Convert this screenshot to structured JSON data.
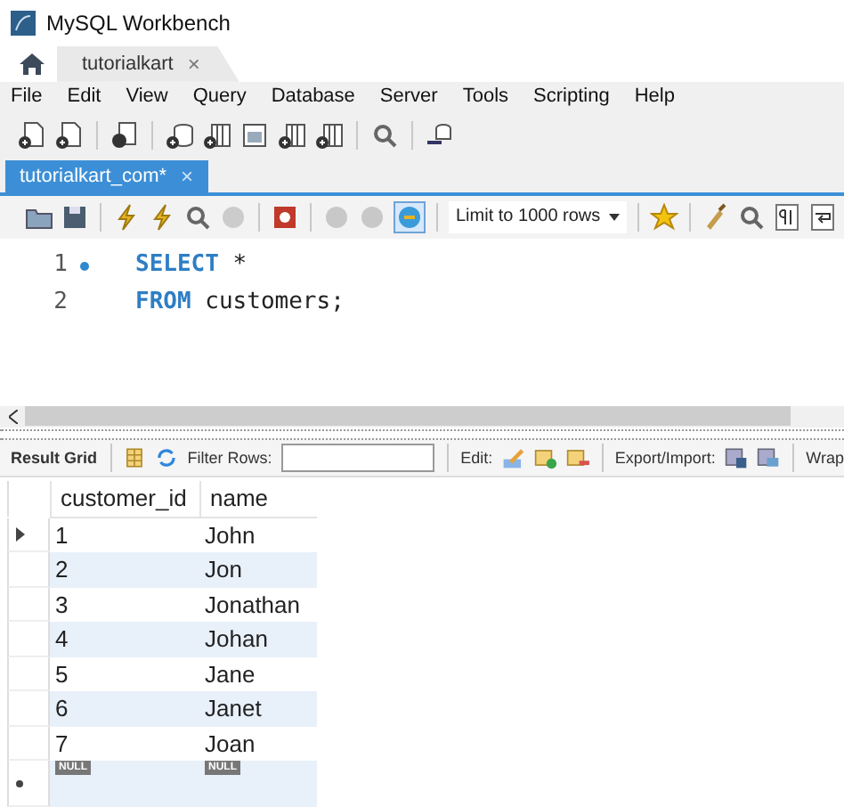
{
  "window": {
    "title": "MySQL Workbench"
  },
  "connection_tab": {
    "label": "tutorialkart",
    "close": "×"
  },
  "menu": [
    "File",
    "Edit",
    "View",
    "Query",
    "Database",
    "Server",
    "Tools",
    "Scripting",
    "Help"
  ],
  "query_tab": {
    "label": "tutorialkart_com*",
    "close": "×"
  },
  "limit_select": {
    "value": "Limit to 1000 rows"
  },
  "editor": {
    "lines": [
      {
        "number": "1",
        "marker": true,
        "keyword": "SELECT",
        "rest": " *"
      },
      {
        "number": "2",
        "marker": false,
        "keyword": "FROM",
        "rest": " customers;"
      }
    ]
  },
  "result_toolbar": {
    "result_grid": "Result Grid",
    "filter_label": "Filter Rows:",
    "edit_label": "Edit:",
    "export_label": "Export/Import:",
    "wrap_label": "Wrap"
  },
  "grid": {
    "columns": [
      "customer_id",
      "name"
    ],
    "rows": [
      {
        "cells": [
          "1",
          "John"
        ],
        "current": true
      },
      {
        "cells": [
          "2",
          "Jon"
        ],
        "current": false
      },
      {
        "cells": [
          "3",
          "Jonathan"
        ],
        "current": false
      },
      {
        "cells": [
          "4",
          "Johan"
        ],
        "current": false
      },
      {
        "cells": [
          "5",
          "Jane"
        ],
        "current": false
      },
      {
        "cells": [
          "6",
          "Janet"
        ],
        "current": false
      },
      {
        "cells": [
          "7",
          "Joan"
        ],
        "current": false
      }
    ],
    "new_row": {
      "cells": [
        "NULL",
        "NULL"
      ]
    }
  }
}
